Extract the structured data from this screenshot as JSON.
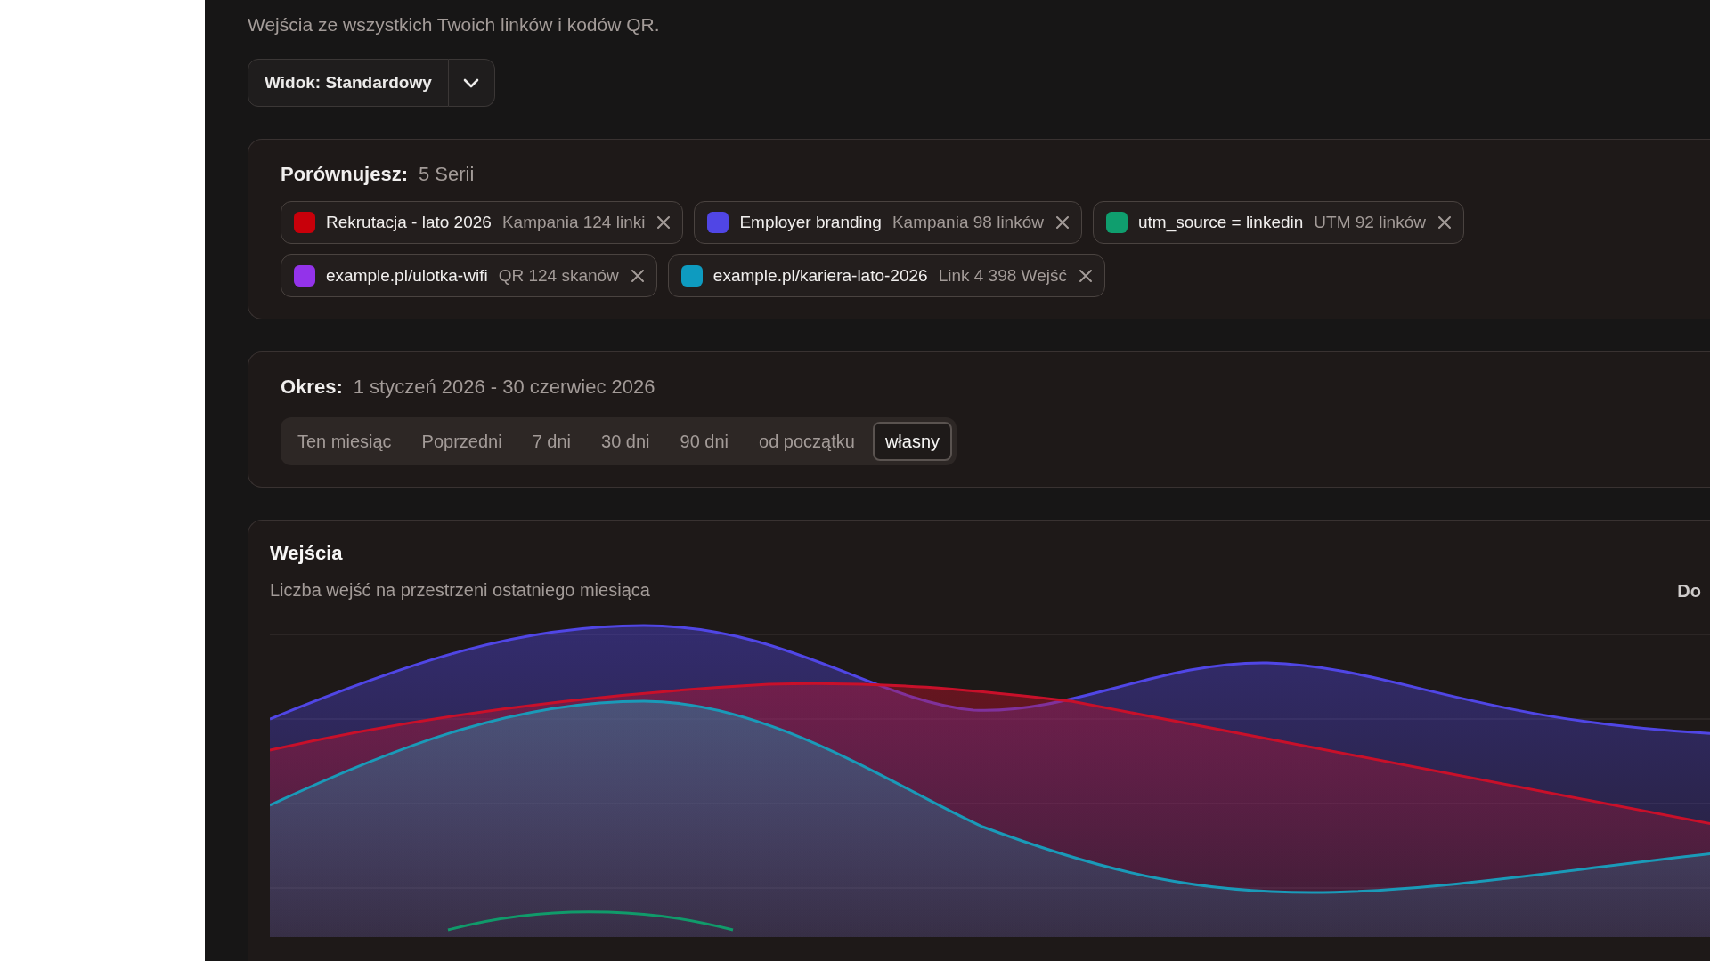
{
  "header": {
    "subtitle": "Wejścia ze wszystkich Twoich linków i kodów QR."
  },
  "view_selector": {
    "label": "Widok: Standardowy"
  },
  "compare": {
    "label": "Porównujesz:",
    "count": "5 Serii",
    "rows": [
      {
        "chips": [
          {
            "name": "Rekrutacja - lato 2026",
            "meta": "Kampania 124 linki",
            "color": "#c8000a"
          },
          {
            "name": "Employer branding",
            "meta": "Kampania 98 linków",
            "color": "#5046e5"
          },
          {
            "name": "utm_source = linkedin",
            "meta": "UTM 92 linków",
            "color": "#0f9e6e"
          }
        ]
      },
      {
        "chips": [
          {
            "name": "example.pl/ulotka-wifi",
            "meta": "QR 124 skanów",
            "color": "#9333ea"
          },
          {
            "name": "example.pl/kariera-lato-2026",
            "meta": "Link 4 398 Wejść",
            "color": "#0e9bc0"
          }
        ]
      }
    ]
  },
  "period": {
    "label": "Okres:",
    "range": "1 styczeń 2026 - 30 czerwiec 2026",
    "options": [
      {
        "label": "Ten miesiąc",
        "selected": false
      },
      {
        "label": "Poprzedni",
        "selected": false
      },
      {
        "label": "7 dni",
        "selected": false
      },
      {
        "label": "30 dni",
        "selected": false
      },
      {
        "label": "90 dni",
        "selected": false
      },
      {
        "label": "od początku",
        "selected": false
      },
      {
        "label": "własny",
        "selected": true
      }
    ]
  },
  "chart_card": {
    "title": "Wejścia",
    "subtitle": "Liczba wejść na przestrzeni ostatniego miesiąca",
    "corner_label": "Do"
  }
}
